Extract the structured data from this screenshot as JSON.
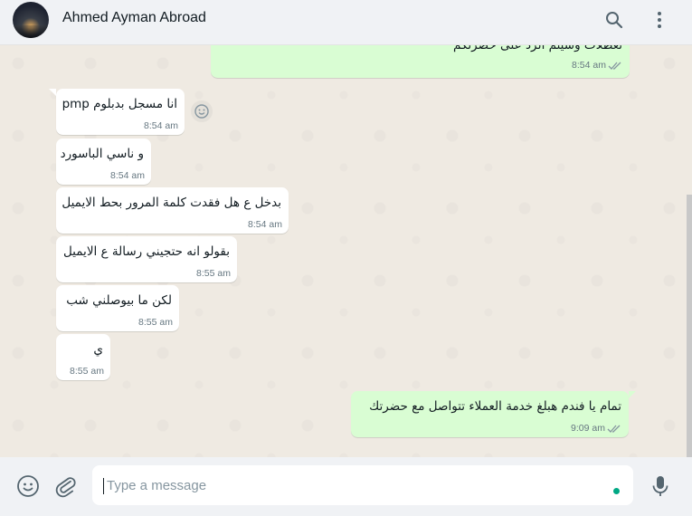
{
  "header": {
    "contact_name": "Ahmed Ayman Abroad",
    "icons": [
      "avatar",
      "search-icon",
      "menu-icon"
    ]
  },
  "messages": [
    {
      "direction": "out",
      "text": "تعطلات وسيتم الرد على حضرتكم",
      "time": "8:54 am",
      "status": "read"
    },
    {
      "direction": "in",
      "text": "انا مسجل بدبلوم pmp",
      "time": "8:54 am"
    },
    {
      "direction": "in",
      "text": "و ناسي الباسورد",
      "time": "8:54 am"
    },
    {
      "direction": "in",
      "text": "بدخل ع هل فقدت كلمة المرور بحط الايميل",
      "time": "8:54 am"
    },
    {
      "direction": "in",
      "text": "بقولو انه حتجيني رسالة ع الايميل",
      "time": "8:55 am"
    },
    {
      "direction": "in",
      "text": "لكن ما بيوصلني شب",
      "time": "8:55 am"
    },
    {
      "direction": "in",
      "text": "ي",
      "time": "8:55 am"
    },
    {
      "direction": "out",
      "text": "تمام يا فندم هبلغ خدمة العملاء تتواصل مع حضرتك",
      "time": "9:09 am",
      "status": "read"
    }
  ],
  "composer": {
    "placeholder": "Type a message",
    "icons": [
      "emoji-icon",
      "attach-icon",
      "mic-icon"
    ]
  },
  "colors": {
    "chat_background": "#efeae2",
    "incoming_bubble": "#ffffff",
    "outgoing_bubble": "#d9fdd3",
    "header_background": "#f0f2f5",
    "read_ticks": "#8696a0",
    "accent": "#00a884"
  }
}
